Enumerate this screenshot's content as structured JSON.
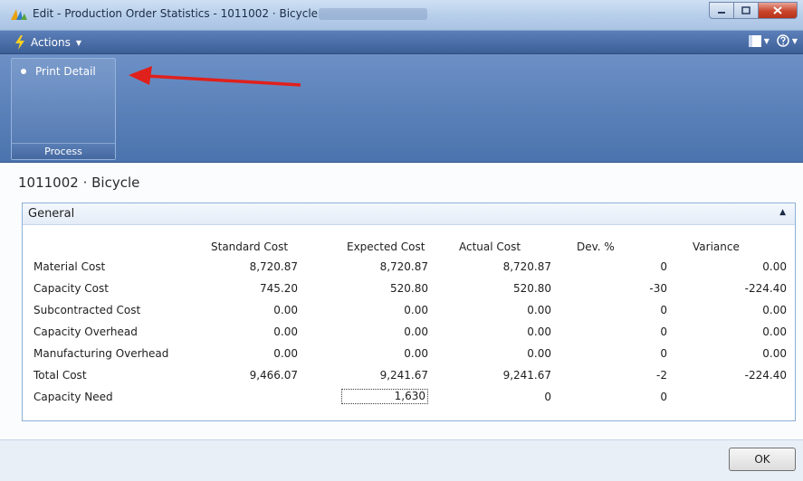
{
  "window": {
    "title": "Edit - Production Order Statistics - 1011002 · Bicycle"
  },
  "actions_bar": {
    "actions_label": "Actions"
  },
  "ribbon": {
    "group_label": "Process",
    "print_detail_label": "Print Detail"
  },
  "page": {
    "title": "1011002 · Bicycle"
  },
  "panel": {
    "title": "General",
    "columns": [
      "Standard Cost",
      "Expected Cost",
      "Actual Cost",
      "Dev. %",
      "Variance"
    ],
    "rows": [
      {
        "label": "Material Cost",
        "standard": "8,720.87",
        "expected": "8,720.87",
        "actual": "8,720.87",
        "dev": "0",
        "variance": "0.00"
      },
      {
        "label": "Capacity Cost",
        "standard": "745.20",
        "expected": "520.80",
        "actual": "520.80",
        "dev": "-30",
        "variance": "-224.40"
      },
      {
        "label": "Subcontracted Cost",
        "standard": "0.00",
        "expected": "0.00",
        "actual": "0.00",
        "dev": "0",
        "variance": "0.00"
      },
      {
        "label": "Capacity Overhead",
        "standard": "0.00",
        "expected": "0.00",
        "actual": "0.00",
        "dev": "0",
        "variance": "0.00"
      },
      {
        "label": "Manufacturing Overhead",
        "standard": "0.00",
        "expected": "0.00",
        "actual": "0.00",
        "dev": "0",
        "variance": "0.00"
      },
      {
        "label": "Total Cost",
        "standard": "9,466.07",
        "expected": "9,241.67",
        "actual": "9,241.67",
        "dev": "-2",
        "variance": "-224.40"
      },
      {
        "label": "Capacity Need",
        "standard": "",
        "expected": "1,630",
        "actual": "0",
        "dev": "0",
        "variance": ""
      }
    ]
  },
  "footer": {
    "ok_label": "OK"
  },
  "colors": {
    "ribbon": "#5a7fb6",
    "arrow": "#e0201c",
    "panel_border": "#8fb0d8"
  },
  "icons": {
    "app": "dynamics-nav-icon",
    "actions": "lightning-icon",
    "help": "help-icon",
    "layout": "layout-icon"
  }
}
